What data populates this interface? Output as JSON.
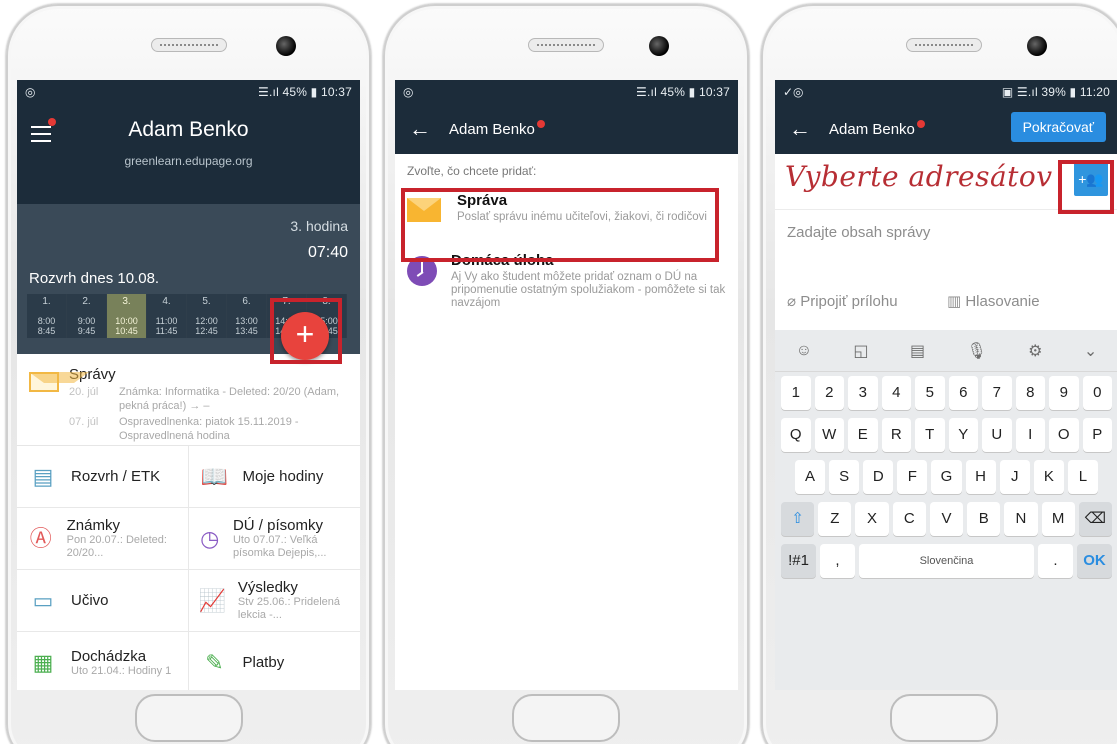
{
  "status1": {
    "left": "◎",
    "right": "☰.ıl 45% ▮ 10:37"
  },
  "status3": {
    "left": "✓◎",
    "right": "▣ ☰.ıl 39% ▮ 11:20"
  },
  "screen1": {
    "name": "Adam Benko",
    "domain": "greenlearn.edupage.org",
    "lesson": "3. hodina",
    "lesson_time": "07:40",
    "today": "Rozvrh dnes 10.08.",
    "periods": [
      {
        "n": "1.",
        "a": "8:00",
        "b": "8:45"
      },
      {
        "n": "2.",
        "a": "9:00",
        "b": "9:45"
      },
      {
        "n": "3.",
        "a": "10:00",
        "b": "10:45"
      },
      {
        "n": "4.",
        "a": "11:00",
        "b": "11:45"
      },
      {
        "n": "5.",
        "a": "12:00",
        "b": "12:45"
      },
      {
        "n": "6.",
        "a": "13:00",
        "b": "13:45"
      },
      {
        "n": "7.",
        "a": "14:00",
        "b": "14:45"
      },
      {
        "n": "8.",
        "a": "15:00",
        "b": "15:45"
      }
    ],
    "fab": "+",
    "messages": {
      "title": "Správy",
      "items": [
        {
          "date": "20. júl",
          "text": "Známka: Informatika - Deleted: 20/20 (Adam, pekná práca!) → –"
        },
        {
          "date": "07. júl",
          "text": "Ospravedlnenka: piatok 15.11.2019 - Ospravedlnená hodina"
        }
      ]
    },
    "tiles": [
      {
        "label": "Rozvrh / ETK",
        "sub": ""
      },
      {
        "label": "Moje hodiny",
        "sub": ""
      },
      {
        "label": "Známky",
        "sub": "Pon 20.07.: Deleted: 20/20..."
      },
      {
        "label": "DÚ / písomky",
        "sub": "Uto 07.07.: Veľká písomka Dejepis,..."
      },
      {
        "label": "Učivo",
        "sub": ""
      },
      {
        "label": "Výsledky",
        "sub": "Stv 25.06.: Pridelená lekcia -..."
      },
      {
        "label": "Dochádzka",
        "sub": "Uto 21.04.: Hodiny 1"
      },
      {
        "label": "Platby",
        "sub": ""
      }
    ]
  },
  "screen2": {
    "back": "←",
    "title": "Adam Benko",
    "prompt": "Zvoľte, čo chcete pridať:",
    "items": [
      {
        "title": "Správa",
        "desc": "Poslať správu inému učiteľovi, žiakovi, či rodičovi"
      },
      {
        "title": "Domáca úloha",
        "desc": "Aj Vy ako študent môžete pridať oznam o DÚ na pripomenutie ostatným spolužiakom - pomôžete si tak navzájom"
      }
    ]
  },
  "screen3": {
    "back": "←",
    "title": "Adam Benko",
    "continue": "Pokračovať",
    "recipients_hint": "Vyberte adresátov",
    "add_recipient_icon": "+👥",
    "body_placeholder": "Zadajte obsah správy",
    "attach": "Pripojiť prílohu",
    "vote": "Hlasovanie",
    "keyboard": {
      "tools": [
        "☺",
        "◱",
        "▤",
        "🎙",
        "⚙",
        "⌄"
      ],
      "row1": [
        "1",
        "2",
        "3",
        "4",
        "5",
        "6",
        "7",
        "8",
        "9",
        "0"
      ],
      "row2": [
        "Q",
        "W",
        "E",
        "R",
        "T",
        "Y",
        "U",
        "I",
        "O",
        "P"
      ],
      "row3": [
        "A",
        "S",
        "D",
        "F",
        "G",
        "H",
        "J",
        "K",
        "L"
      ],
      "row4": [
        "⇧",
        "Z",
        "X",
        "C",
        "V",
        "B",
        "N",
        "M",
        "⌫"
      ],
      "sym": "!#1",
      "comma": ",",
      "space": "Slovenčina",
      "dot": ".",
      "ok": "OK"
    }
  }
}
